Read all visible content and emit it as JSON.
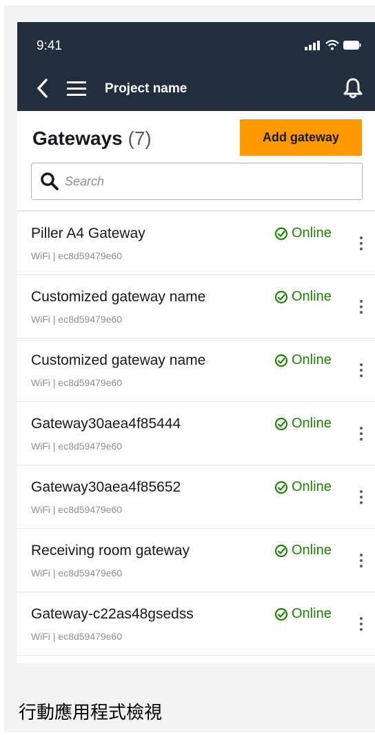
{
  "status_bar": {
    "time": "9:41"
  },
  "navbar": {
    "project_title": "Project name"
  },
  "page": {
    "title": "Gateways",
    "count": "(7)",
    "add_button_label": "Add gateway"
  },
  "search": {
    "placeholder": "Search"
  },
  "gateways": [
    {
      "name": "Piller A4 Gateway",
      "meta": "WiFi | ec8d59479e60",
      "status": "Online"
    },
    {
      "name": "Customized gateway name",
      "meta": "WiFi | ec8d59479e60",
      "status": "Online"
    },
    {
      "name": "Customized gateway name",
      "meta": "WiFi | ec8d59479e60",
      "status": "Online"
    },
    {
      "name": "Gateway30aea4f85444",
      "meta": "WiFi | ec8d59479e60",
      "status": "Online"
    },
    {
      "name": "Gateway30aea4f85652",
      "meta": "WiFi | ec8d59479e60",
      "status": "Online"
    },
    {
      "name": "Receiving room gateway",
      "meta": "WiFi | ec8d59479e60",
      "status": "Online"
    },
    {
      "name": "Gateway-c22as48gsedss",
      "meta": "WiFi | ec8d59479e60",
      "status": "Online"
    }
  ],
  "caption": "行動應用程式檢視",
  "colors": {
    "navbar": "#232f3e",
    "accent": "#ff9900",
    "online": "#1d8102"
  },
  "icons": [
    "back-icon",
    "menu-icon",
    "bell-icon",
    "search-icon",
    "check-circle-icon",
    "more-vertical-icon",
    "signal-icon",
    "wifi-icon",
    "battery-icon"
  ]
}
